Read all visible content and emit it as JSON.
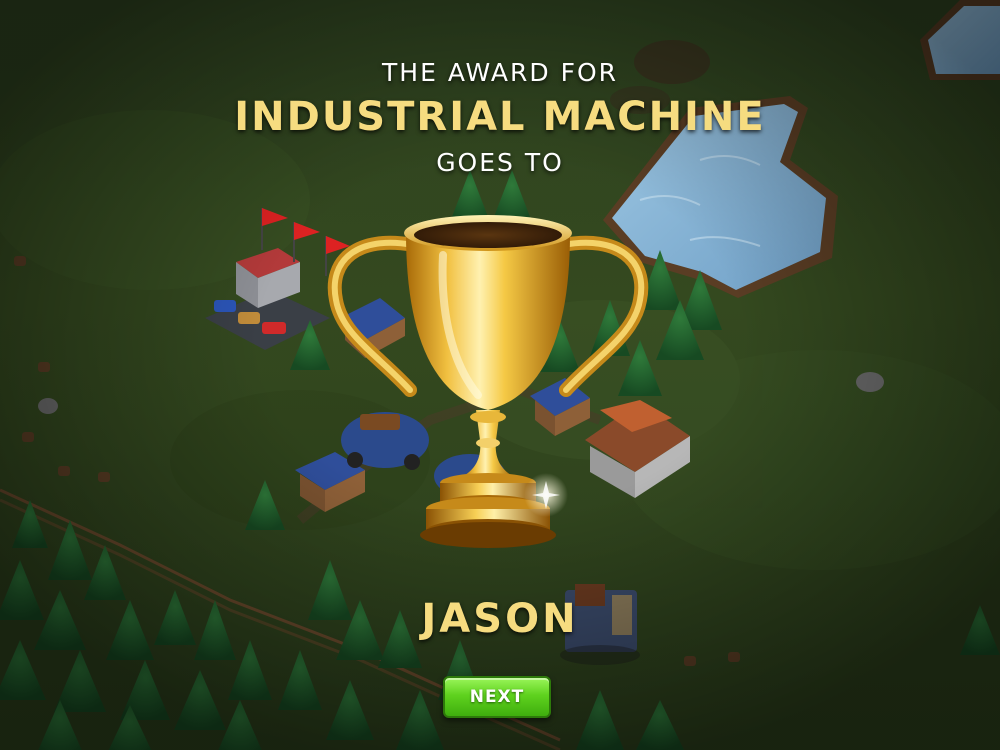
{
  "award": {
    "pre_text": "THE AWARD FOR",
    "category": "INDUSTRIAL MACHINE",
    "post_text": "GOES TO"
  },
  "winner": {
    "name": "JASON"
  },
  "next_button": {
    "label": "NEXT"
  },
  "icons": {
    "trophy": "trophy-icon"
  },
  "colors": {
    "gold_text": "#f6dc80",
    "white_text": "#ffffff",
    "button_green": "#5fd21e",
    "grass": "#34491f",
    "water": "#8ab8d8"
  }
}
